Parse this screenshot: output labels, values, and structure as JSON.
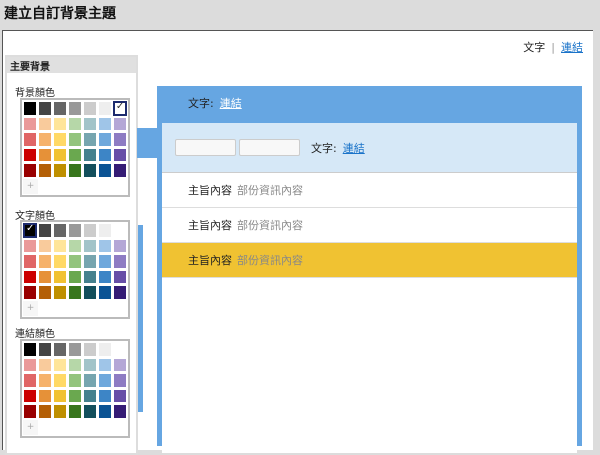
{
  "title": "建立自訂背景主題",
  "top_links": {
    "text": "文字",
    "separator": "|",
    "link": "連結"
  },
  "panel": {
    "header": "主要背景",
    "palettes": [
      {
        "label": "背景顏色",
        "selected": "#ffffff"
      },
      {
        "label": "文字顏色",
        "selected": "#000000"
      },
      {
        "label": "連結顏色",
        "selected": null
      }
    ],
    "add_label": "+"
  },
  "colors": [
    [
      "#000000",
      "#444444",
      "#666666",
      "#999999",
      "#cccccc",
      "#eeeeee",
      "#ffffff"
    ],
    [
      "#ea9999",
      "#f9cb9c",
      "#ffe599",
      "#b6d7a8",
      "#a2c4c9",
      "#9fc5e8",
      "#b4a7d6"
    ],
    [
      "#e06666",
      "#f6b26b",
      "#ffd966",
      "#93c47d",
      "#76a5af",
      "#6fa8dc",
      "#8e7cc3"
    ],
    [
      "#cc0000",
      "#e69138",
      "#f1c232",
      "#6aa84f",
      "#45818e",
      "#3d85c6",
      "#674ea7"
    ],
    [
      "#990000",
      "#b45f06",
      "#bf9000",
      "#38761d",
      "#134f5c",
      "#0b5394",
      "#351c75"
    ]
  ],
  "preview": {
    "header": {
      "text": "文字:",
      "link": "連結"
    },
    "band": {
      "text": "文字:",
      "link": "連結"
    },
    "rows": [
      {
        "title": "主旨內容",
        "snippet": "部份資訊內容"
      },
      {
        "title": "主旨內容",
        "snippet": "部份資訊內容"
      },
      {
        "title": "主旨內容",
        "snippet": "部份資訊內容"
      }
    ],
    "accent": "#66a6e2",
    "highlight": "#f0c232"
  }
}
